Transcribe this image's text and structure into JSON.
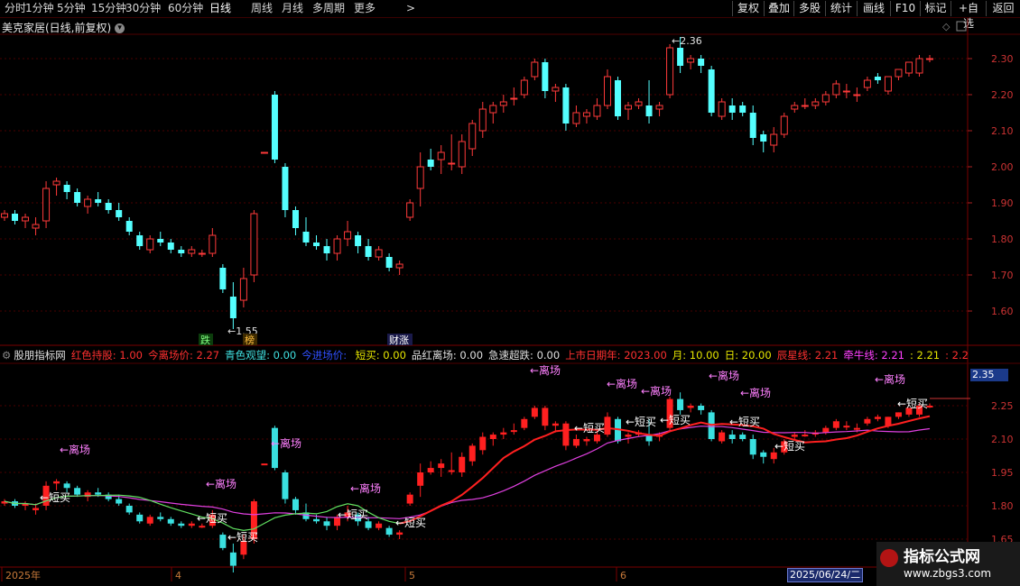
{
  "topbar": {
    "periods": [
      "分时",
      "1分钟",
      "5分钟",
      "15分钟",
      "30分钟",
      "60分钟",
      "日线",
      "周线",
      "月线",
      "多周期",
      "更多"
    ],
    "active_period": "日线",
    "more_arrow": ">",
    "right_buttons": [
      "复权",
      "叠加",
      "多股",
      "统计",
      "画线",
      "F10",
      "标记",
      "+自选",
      "返回"
    ]
  },
  "chart_title": "美克家居(日线,前复权)",
  "main_axis": {
    "labels": [
      "2.30",
      "2.20",
      "2.10",
      "2.00",
      "1.90",
      "1.80",
      "1.70",
      "1.60"
    ]
  },
  "sub_axis": {
    "labels": [
      "2.25",
      "2.10",
      "1.95",
      "1.80",
      "1.65"
    ],
    "current": "2.35"
  },
  "annotations": {
    "high": "2.36",
    "low": "1.55",
    "tag_die": "跌",
    "tag_bang": "榜",
    "tag_caizhang": "财涨"
  },
  "indicator": {
    "name": "股朋指标网",
    "items": [
      {
        "text": "红色持股: 1.00",
        "color": "#ff3030"
      },
      {
        "text": "今离场价: 2.27",
        "color": "#ff3030"
      },
      {
        "text": "青色观望: 0.00",
        "color": "#40e0e0"
      },
      {
        "text": "今进场价: ",
        "color": "#3050ff"
      },
      {
        "text": "短买: 0.00",
        "color": "#e6e600"
      },
      {
        "text": "品红离场: 0.00",
        "color": "#e0e0e0"
      },
      {
        "text": "急速超跌: 0.00",
        "color": "#e0e0e0"
      },
      {
        "text": "上市日期年: 2023.00",
        "color": "#ff3030"
      },
      {
        "text": "月: 10.00",
        "color": "#e6e600"
      },
      {
        "text": "日: 20.00",
        "color": "#e6e600"
      },
      {
        "text": "辰星线: 2.21",
        "color": "#ff3030"
      },
      {
        "text": "牵牛线: 2.21",
        "color": "#ff40ff"
      },
      {
        "text": ": 2.21",
        "color": "#e6e600"
      },
      {
        "text": ": 2.21",
        "color": "#ff3030"
      },
      {
        "text": ": 2.2",
        "color": "#ff3030"
      }
    ]
  },
  "sub_labels": {
    "exit": "←离场",
    "buy": "短买"
  },
  "xaxis": {
    "labels": [
      "2025年",
      "4",
      "5",
      "6"
    ],
    "cursor_date": "2025/06/24/二"
  },
  "watermark": {
    "title": "指标公式网",
    "url": "www.zbgs3.com"
  },
  "chart_data": {
    "type": "candlestick",
    "ylim": [
      1.55,
      2.36
    ],
    "candles": [
      [
        1.86,
        1.88,
        1.85,
        1.87
      ],
      [
        1.87,
        1.88,
        1.84,
        1.85
      ],
      [
        1.85,
        1.87,
        1.83,
        1.86
      ],
      [
        1.83,
        1.86,
        1.81,
        1.84
      ],
      [
        1.85,
        1.96,
        1.83,
        1.94
      ],
      [
        1.95,
        1.97,
        1.92,
        1.96
      ],
      [
        1.95,
        1.96,
        1.91,
        1.93
      ],
      [
        1.93,
        1.94,
        1.89,
        1.9
      ],
      [
        1.89,
        1.92,
        1.87,
        1.91
      ],
      [
        1.91,
        1.93,
        1.89,
        1.9
      ],
      [
        1.9,
        1.91,
        1.87,
        1.88
      ],
      [
        1.88,
        1.9,
        1.85,
        1.86
      ],
      [
        1.85,
        1.86,
        1.81,
        1.82
      ],
      [
        1.81,
        1.82,
        1.77,
        1.78
      ],
      [
        1.77,
        1.81,
        1.76,
        1.8
      ],
      [
        1.8,
        1.82,
        1.78,
        1.79
      ],
      [
        1.79,
        1.8,
        1.76,
        1.77
      ],
      [
        1.77,
        1.78,
        1.75,
        1.76
      ],
      [
        1.76,
        1.78,
        1.75,
        1.77
      ],
      [
        1.76,
        1.77,
        1.75,
        1.76
      ],
      [
        1.76,
        1.83,
        1.75,
        1.81
      ],
      [
        1.72,
        1.73,
        1.65,
        1.66
      ],
      [
        1.64,
        1.68,
        1.55,
        1.58
      ],
      [
        1.63,
        1.72,
        1.61,
        1.69
      ],
      [
        1.7,
        1.88,
        1.68,
        1.87
      ],
      [
        2.04,
        2.04,
        2.04,
        2.04
      ],
      [
        2.2,
        2.21,
        2.01,
        2.02
      ],
      [
        2.0,
        2.01,
        1.86,
        1.88
      ],
      [
        1.88,
        1.89,
        1.81,
        1.83
      ],
      [
        1.82,
        1.86,
        1.78,
        1.79
      ],
      [
        1.79,
        1.81,
        1.77,
        1.78
      ],
      [
        1.78,
        1.8,
        1.74,
        1.76
      ],
      [
        1.76,
        1.81,
        1.74,
        1.8
      ],
      [
        1.8,
        1.85,
        1.78,
        1.82
      ],
      [
        1.81,
        1.82,
        1.76,
        1.78
      ],
      [
        1.78,
        1.8,
        1.74,
        1.75
      ],
      [
        1.75,
        1.78,
        1.74,
        1.77
      ],
      [
        1.75,
        1.76,
        1.71,
        1.72
      ],
      [
        1.72,
        1.74,
        1.7,
        1.73
      ],
      [
        1.86,
        1.91,
        1.85,
        1.9
      ],
      [
        1.94,
        2.04,
        1.89,
        2.0
      ],
      [
        2.02,
        2.05,
        1.99,
        2.0
      ],
      [
        2.02,
        2.06,
        1.98,
        2.04
      ],
      [
        2.01,
        2.09,
        1.99,
        2.01
      ],
      [
        2.0,
        2.09,
        1.98,
        2.07
      ],
      [
        2.05,
        2.13,
        2.03,
        2.12
      ],
      [
        2.1,
        2.18,
        2.08,
        2.16
      ],
      [
        2.15,
        2.18,
        2.12,
        2.17
      ],
      [
        2.17,
        2.2,
        2.15,
        2.18
      ],
      [
        2.19,
        2.22,
        2.17,
        2.19
      ],
      [
        2.2,
        2.25,
        2.19,
        2.24
      ],
      [
        2.25,
        2.3,
        2.24,
        2.29
      ],
      [
        2.29,
        2.3,
        2.19,
        2.21
      ],
      [
        2.21,
        2.23,
        2.18,
        2.22
      ],
      [
        2.22,
        2.23,
        2.1,
        2.12
      ],
      [
        2.12,
        2.17,
        2.11,
        2.15
      ],
      [
        2.14,
        2.16,
        2.12,
        2.15
      ],
      [
        2.14,
        2.19,
        2.13,
        2.17
      ],
      [
        2.17,
        2.27,
        2.16,
        2.25
      ],
      [
        2.24,
        2.25,
        2.13,
        2.14
      ],
      [
        2.16,
        2.18,
        2.13,
        2.17
      ],
      [
        2.17,
        2.19,
        2.16,
        2.18
      ],
      [
        2.17,
        2.24,
        2.12,
        2.14
      ],
      [
        2.16,
        2.18,
        2.14,
        2.17
      ],
      [
        2.2,
        2.34,
        2.19,
        2.33
      ],
      [
        2.33,
        2.36,
        2.26,
        2.28
      ],
      [
        2.29,
        2.31,
        2.27,
        2.3
      ],
      [
        2.3,
        2.31,
        2.26,
        2.28
      ],
      [
        2.27,
        2.28,
        2.14,
        2.15
      ],
      [
        2.14,
        2.19,
        2.13,
        2.18
      ],
      [
        2.17,
        2.19,
        2.13,
        2.15
      ],
      [
        2.17,
        2.18,
        2.14,
        2.15
      ],
      [
        2.15,
        2.17,
        2.06,
        2.08
      ],
      [
        2.09,
        2.1,
        2.04,
        2.07
      ],
      [
        2.06,
        2.11,
        2.04,
        2.09
      ],
      [
        2.09,
        2.15,
        2.08,
        2.14
      ],
      [
        2.16,
        2.18,
        2.15,
        2.17
      ],
      [
        2.17,
        2.19,
        2.16,
        2.17
      ],
      [
        2.17,
        2.19,
        2.16,
        2.18
      ],
      [
        2.18,
        2.21,
        2.17,
        2.2
      ],
      [
        2.2,
        2.24,
        2.19,
        2.23
      ],
      [
        2.21,
        2.23,
        2.19,
        2.21
      ],
      [
        2.2,
        2.22,
        2.18,
        2.2
      ],
      [
        2.22,
        2.25,
        2.21,
        2.24
      ],
      [
        2.25,
        2.26,
        2.23,
        2.24
      ],
      [
        2.21,
        2.25,
        2.2,
        2.25
      ],
      [
        2.25,
        2.27,
        2.24,
        2.27
      ],
      [
        2.26,
        2.29,
        2.25,
        2.29
      ],
      [
        2.26,
        2.31,
        2.25,
        2.3
      ],
      [
        2.3,
        2.31,
        2.29,
        2.3
      ]
    ]
  }
}
